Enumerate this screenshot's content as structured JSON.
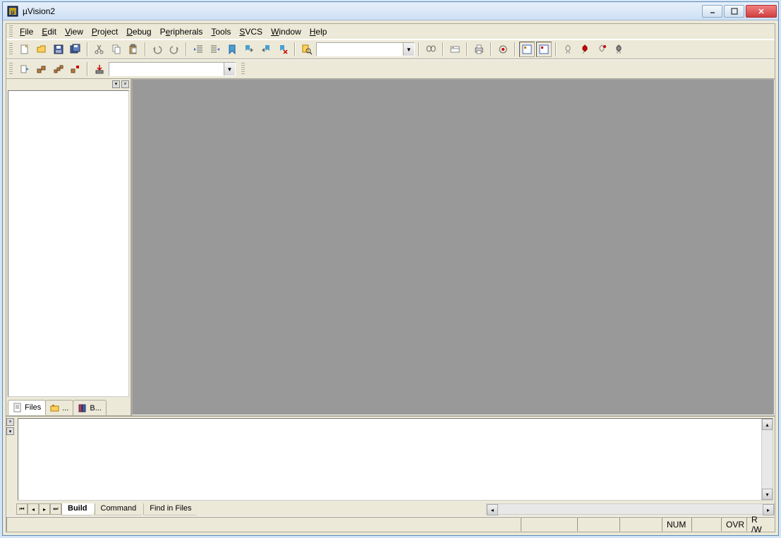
{
  "window": {
    "title": "µVision2"
  },
  "menubar": {
    "file": {
      "label": "File",
      "ul": "F"
    },
    "edit": {
      "label": "Edit",
      "ul": "E"
    },
    "view": {
      "label": "View",
      "ul": "V"
    },
    "project": {
      "label": "Project",
      "ul": "P"
    },
    "debug": {
      "label": "Debug",
      "ul": "D"
    },
    "peripherals": {
      "label": "Peripherals",
      "ul": "e"
    },
    "tools": {
      "label": "Tools",
      "ul": "T"
    },
    "svcs": {
      "label": "SVCS",
      "ul": "S"
    },
    "window": {
      "label": "Window",
      "ul": "W"
    },
    "help": {
      "label": "Help",
      "ul": "H"
    }
  },
  "toolbar1": {
    "search_combo": ""
  },
  "toolbar2": {
    "target_combo": ""
  },
  "project_pane": {
    "tabs": {
      "files": {
        "label": "Files"
      },
      "regs": {
        "label": "..."
      },
      "books": {
        "label": "B..."
      }
    }
  },
  "output_pane": {
    "tabs": {
      "build": {
        "label": "Build"
      },
      "command": {
        "label": "Command"
      },
      "find": {
        "label": "Find in Files"
      }
    }
  },
  "statusbar": {
    "num": "NUM",
    "ovr": "OVR",
    "rw": "R /W"
  }
}
